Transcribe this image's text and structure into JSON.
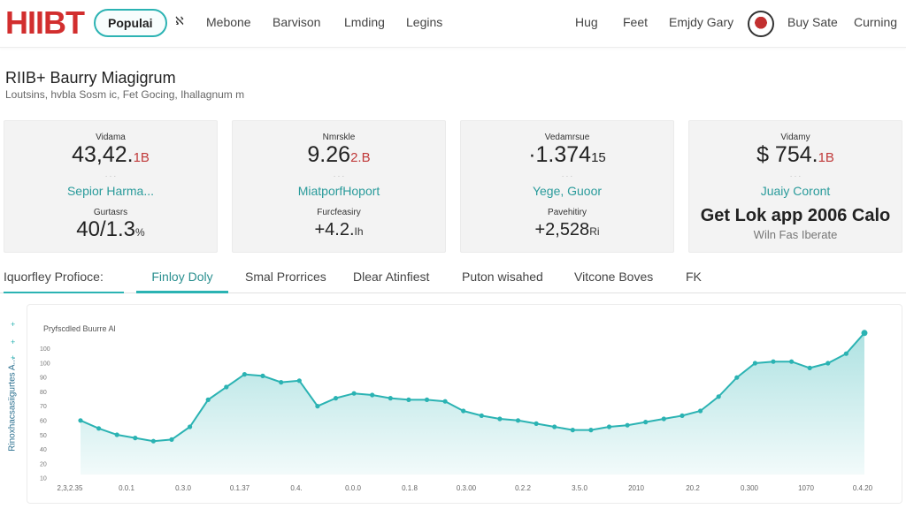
{
  "header": {
    "logo": "HIIBT",
    "pill": "Populai",
    "glyph": "ℵ",
    "nav_left": [
      "Mebone",
      "Barvison",
      "Lmding",
      "Legins"
    ],
    "nav_right": [
      "Hug",
      "Feet",
      "Emjdy Gary",
      "Buy Sate",
      "Curning"
    ]
  },
  "page": {
    "title": "RIIB+ Baurry Miagigrum",
    "subtitle": "Loutsins, hvbla Sosm ic, Fet Gocing, Ihallagnum m"
  },
  "cards": [
    {
      "label1": "Vidama",
      "value1": "43,42.",
      "suffix1": "1B",
      "dots": "· · ·",
      "teal": "Sepior Harma...",
      "label2": "Gurtasrs",
      "value2": "40/1.3",
      "suffix2": "%"
    },
    {
      "label1": "Nmrskle",
      "value1": "9.26",
      "suffix1": "2.B",
      "dots": "· · ·",
      "teal": "MiatporfHoport",
      "label2": "Furcfeasiry",
      "value2": "+4.2.",
      "suffix2": "Ih"
    },
    {
      "label1": "Vedamrsue",
      "value1": "·1.374",
      "suffix1": "15",
      "dots": "· · ·",
      "teal": "Yege, Guoor",
      "label2": "Pavehitiry",
      "value2": "+2,528",
      "suffix2": "Ri"
    },
    {
      "label1": "Vidamy",
      "value1": "$ 754.",
      "suffix1": "1B",
      "dots": "· · ·",
      "teal": "Juaiy Coront",
      "big": "Get Lok app 2006 Calo",
      "gray": "Wiln Fas Iberate"
    }
  ],
  "tabs": [
    {
      "label": "Iquorfley Profioce:"
    },
    {
      "label": "Finloy Doly"
    },
    {
      "label": "Smal Prorrices"
    },
    {
      "label": "Dlear Atinfiest"
    },
    {
      "label": "Puton wisahed"
    },
    {
      "label": "Vitcone Boves"
    },
    {
      "label": "FK"
    }
  ],
  "chart": {
    "title": "Pryfscdled Buurre Al",
    "ylabel": "Rinoxhacsasiigurtes A...",
    "ymarks": [
      "+",
      "+",
      "+"
    ]
  },
  "chart_data": {
    "type": "area",
    "title": "Pryfscdled Buurre Al",
    "xlabel": "",
    "ylabel": "Rinoxhacsasiigurtes A...",
    "y_ticks": [
      "100",
      "100",
      "90",
      "80",
      "70",
      "60",
      "50",
      "40",
      "20",
      "10"
    ],
    "x_ticks": [
      "2,3,2.35",
      "0.0.1",
      "0.3.0",
      "0.1.37",
      "0.4.",
      "0.0.0",
      "0.1.8",
      "0.3.00",
      "0.2.2",
      "3.5.0",
      "2010",
      "20.2",
      "0.300",
      "1070",
      "0.4.20"
    ],
    "values": [
      54,
      49,
      45,
      43,
      41,
      42,
      50,
      67,
      75,
      83,
      82,
      78,
      79,
      63,
      68,
      71,
      70,
      68,
      67,
      67,
      66,
      60,
      57,
      55,
      54,
      52,
      50,
      48,
      48,
      50,
      51,
      53,
      55,
      57,
      60,
      69,
      81,
      90,
      91,
      91,
      87,
      90,
      96,
      109
    ],
    "grid": false,
    "color": "#2bb3b3"
  }
}
